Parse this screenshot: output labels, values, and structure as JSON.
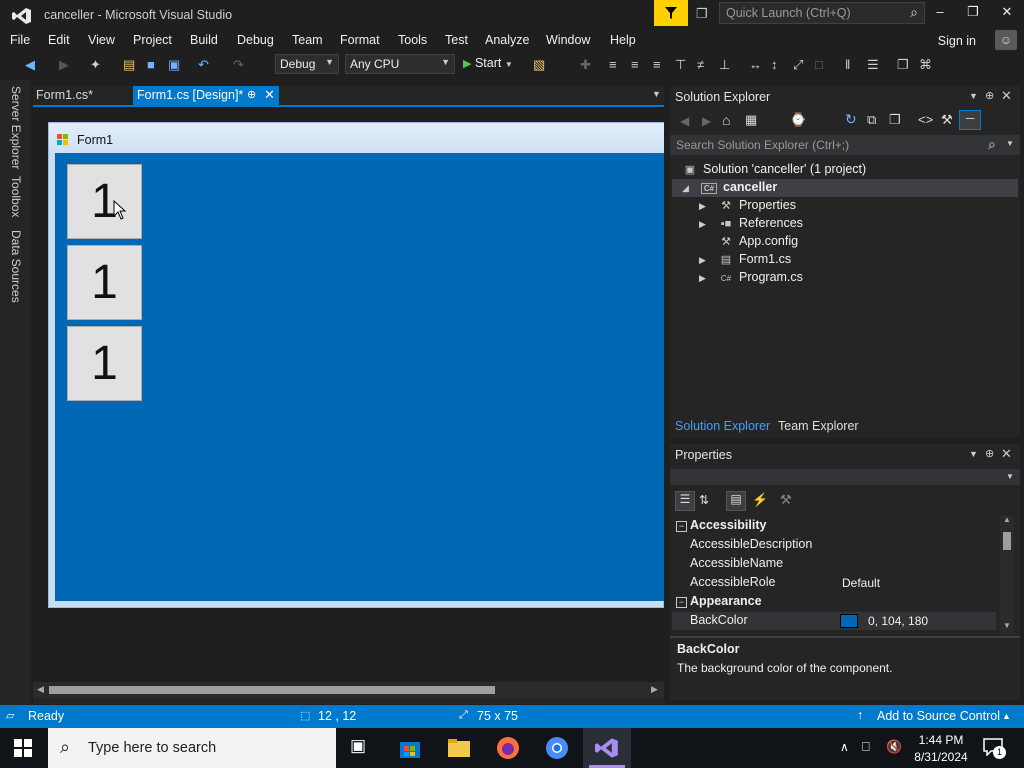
{
  "window": {
    "title": "canceller - Microsoft Visual Studio",
    "quick_launch_placeholder": "Quick Launch (Ctrl+Q)",
    "sign_in": "Sign in"
  },
  "menu": [
    "File",
    "Edit",
    "View",
    "Project",
    "Build",
    "Debug",
    "Team",
    "Format",
    "Tools",
    "Test",
    "Analyze",
    "Window",
    "Help"
  ],
  "toolbar": {
    "config": "Debug",
    "platform": "Any CPU",
    "start": "Start"
  },
  "side_tabs": [
    "Server Explorer",
    "Toolbox",
    "Data Sources"
  ],
  "doc_tabs": [
    {
      "label": "Form1.cs*",
      "active": false
    },
    {
      "label": "Form1.cs [Design]*",
      "active": true
    }
  ],
  "form": {
    "title": "Form1",
    "back_color": "#0068b4",
    "buttons": [
      "1",
      "1",
      "1"
    ]
  },
  "solution_explorer": {
    "title": "Solution Explorer",
    "search_placeholder": "Search Solution Explorer (Ctrl+;)",
    "solution": "Solution 'canceller' (1 project)",
    "project": "canceller",
    "items": [
      {
        "label": "Properties",
        "icon": "wrench-icon",
        "expandable": true
      },
      {
        "label": "References",
        "icon": "references-icon",
        "expandable": true
      },
      {
        "label": "App.config",
        "icon": "config-icon",
        "expandable": false
      },
      {
        "label": "Form1.cs",
        "icon": "form-icon",
        "expandable": true
      },
      {
        "label": "Program.cs",
        "icon": "csharp-file-icon",
        "expandable": true
      }
    ],
    "tabs": [
      "Solution Explorer",
      "Team Explorer"
    ]
  },
  "properties": {
    "title": "Properties",
    "categories": [
      {
        "name": "Accessibility",
        "props": [
          {
            "name": "AccessibleDescription",
            "value": ""
          },
          {
            "name": "AccessibleName",
            "value": ""
          },
          {
            "name": "AccessibleRole",
            "value": "Default"
          }
        ]
      },
      {
        "name": "Appearance",
        "props": [
          {
            "name": "BackColor",
            "value": "0, 104, 180"
          }
        ]
      }
    ],
    "description_title": "BackColor",
    "description_text": "The background color of the component."
  },
  "status": {
    "state": "Ready",
    "position": "12 , 12",
    "size": "75 x 75",
    "source_control": "Add to Source Control"
  },
  "taskbar": {
    "search_placeholder": "Type here to search",
    "time": "1:44 PM",
    "date": "8/31/2024",
    "notification_count": "1"
  },
  "colors": {
    "accent": "#007acc",
    "background": "#1f1f1f",
    "panel": "#252526"
  }
}
